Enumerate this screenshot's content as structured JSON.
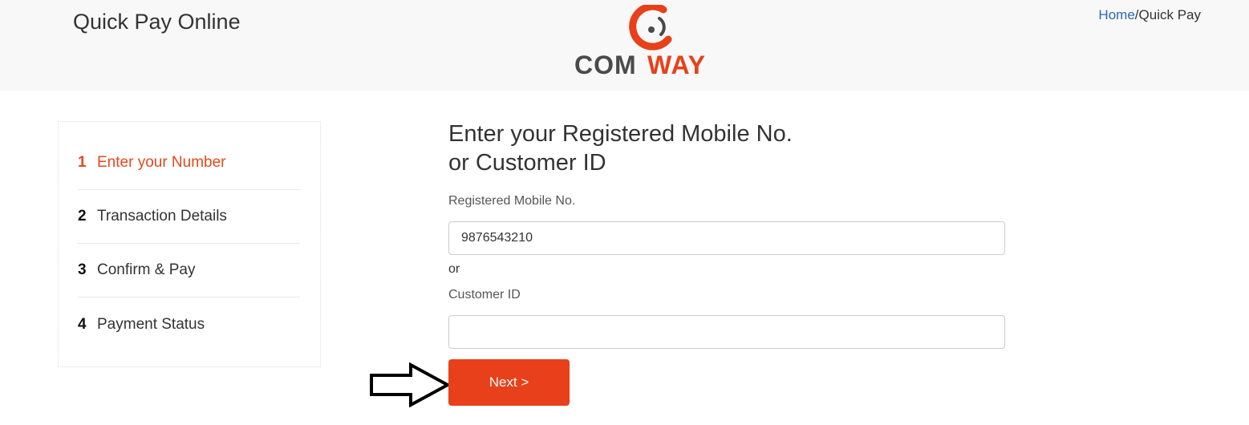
{
  "header": {
    "title": "Quick Pay Online",
    "logo_text": "COMWAY",
    "breadcrumb": {
      "home": "Home",
      "separator": "/",
      "current": "Quick Pay"
    }
  },
  "steps": [
    {
      "number": "1",
      "label": "Enter your Number",
      "active": true
    },
    {
      "number": "2",
      "label": "Transaction Details",
      "active": false
    },
    {
      "number": "3",
      "label": "Confirm & Pay",
      "active": false
    },
    {
      "number": "4",
      "label": "Payment Status",
      "active": false
    }
  ],
  "form": {
    "heading_line1": "Enter your Registered Mobile No.",
    "heading_line2": "or Customer ID",
    "mobile_label": "Registered Mobile No.",
    "mobile_value": "9876543210",
    "or_text": "or",
    "customer_label": "Customer ID",
    "customer_value": "",
    "next_label": "Next >"
  },
  "colors": {
    "accent": "#e8401a",
    "link": "#2a6ab5",
    "logo_gray": "#4a4a4a"
  }
}
